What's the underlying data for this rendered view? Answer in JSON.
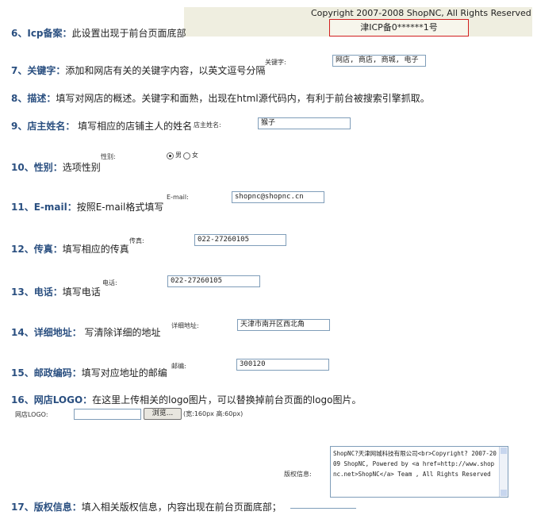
{
  "copyright_preview": {
    "text": "Copyright 2007-2008 ShopNC, All Rights Reserved",
    "icp": "津ICP备0******1号"
  },
  "items": [
    {
      "label": "6、Icp备案：",
      "desc": "此设置出现于前台页面底部"
    },
    {
      "label": "7、关键字：",
      "desc": "添加和网店有关的关键字内容，以英文逗号分隔"
    },
    {
      "label": "8、描述：",
      "desc": "填写对网店的概述。关键字和面熟，出现在html源代码内，有利于前台被搜索引擎抓取。"
    },
    {
      "label": "9、店主姓名：",
      "desc": " 填写相应的店铺主人的姓名"
    },
    {
      "label": "10、性别：",
      "desc": "选项性别"
    },
    {
      "label": "11、E-mail：",
      "desc": "按照E-mail格式填写"
    },
    {
      "label": "12、传真：",
      "desc": "填写相应的传真"
    },
    {
      "label": "13、电话：",
      "desc": "填写电话"
    },
    {
      "label": "14、详细地址：",
      "desc": " 写清除详细的地址"
    },
    {
      "label": "15、邮政编码：",
      "desc": "填写对应地址的邮编"
    },
    {
      "label": "16、网店LOGO：",
      "desc": "在这里上传相关的logo图片，可以替换掉前台页面的logo图片。"
    },
    {
      "label": "17、版权信息：",
      "desc": "填入相关版权信息，内容出现在前台页面底部；"
    }
  ],
  "fields": {
    "keywords": {
      "label": "关键字:",
      "value": "网店, 商店, 商城, 电子"
    },
    "owner": {
      "label": "店主姓名:",
      "value": "猴子"
    },
    "gender": {
      "label": "性别:",
      "male": "男",
      "female": "女",
      "selected": "男"
    },
    "email": {
      "label": "E-mail:",
      "value": "shopnc@shopnc.cn"
    },
    "fax": {
      "label": "传真:",
      "value": "022-27260105"
    },
    "phone": {
      "label": "电话:",
      "value": "022-27260105"
    },
    "address": {
      "label": "详细地址:",
      "value": "天津市南开区西北角"
    },
    "zip": {
      "label": "邮编:",
      "value": "300120"
    },
    "logo": {
      "label": "网店LOGO:",
      "browse": "浏览...",
      "hint": "(宽:160px 高:60px)"
    },
    "copyright": {
      "label": "版权信息:",
      "value": "ShopNC?天津网城科技有限公司<br>Copyright? 2007-2009 ShopNC, Powered by <a href=http://www.shopnc.net>ShopNC</a> Team , All Rights Reserved"
    }
  }
}
